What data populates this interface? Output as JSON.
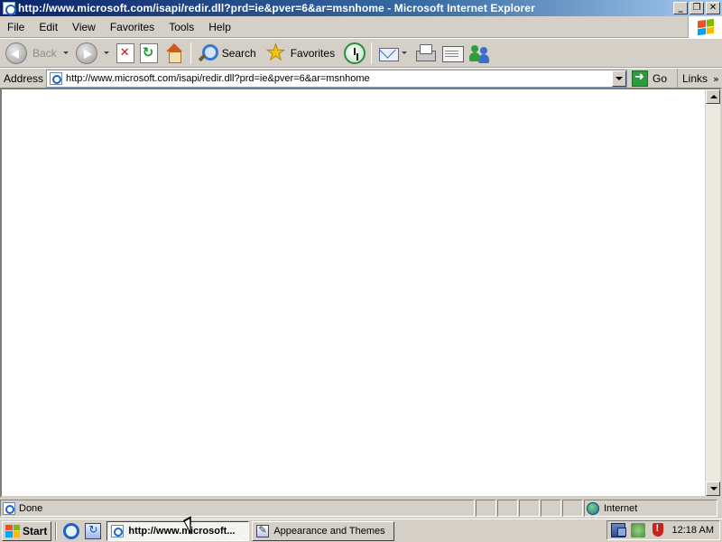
{
  "window": {
    "title": "http://www.microsoft.com/isapi/redir.dll?prd=ie&pver=6&ar=msnhome - Microsoft Internet Explorer",
    "controls": {
      "minimize": "_",
      "maximize": "❐",
      "close": "✕"
    }
  },
  "menubar": {
    "items": [
      {
        "label": "File"
      },
      {
        "label": "Edit"
      },
      {
        "label": "View"
      },
      {
        "label": "Favorites"
      },
      {
        "label": "Tools"
      },
      {
        "label": "Help"
      }
    ]
  },
  "toolbar": {
    "back_label": "Back",
    "search_label": "Search",
    "favorites_label": "Favorites"
  },
  "addressbar": {
    "label": "Address",
    "url": "http://www.microsoft.com/isapi/redir.dll?prd=ie&pver=6&ar=msnhome",
    "go_label": "Go",
    "links_label": "Links",
    "links_chevron": "»"
  },
  "statusbar": {
    "status_text": "Done",
    "zone_text": "Internet"
  },
  "taskbar": {
    "start_label": "Start",
    "tasks": [
      {
        "label": "http://www.microsoft...",
        "active": true
      },
      {
        "label": "Appearance and Themes",
        "active": false
      }
    ],
    "clock": "12:18 AM"
  },
  "colors": {
    "titlebar_start": "#0a246a",
    "titlebar_end": "#a6caf0",
    "face": "#d4d0c8",
    "xp_flag": [
      "#f25022",
      "#7fba00",
      "#00a4ef",
      "#ffb900"
    ]
  }
}
